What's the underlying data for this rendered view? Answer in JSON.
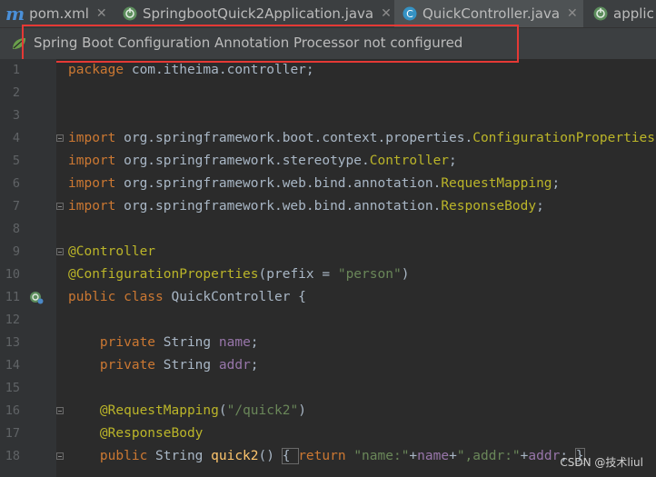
{
  "tabs": [
    {
      "icon": "maven-m-icon",
      "label": "pom.xml",
      "active": false
    },
    {
      "icon": "spring-boot-icon",
      "label": "SpringbootQuick2Application.java",
      "active": false
    },
    {
      "icon": "java-class-icon",
      "label": "QuickController.java",
      "active": true
    },
    {
      "icon": "spring-boot-icon",
      "label": "applic",
      "active": false
    }
  ],
  "tab_close_glyph": "✕",
  "banner": {
    "text": "Spring Boot Configuration Annotation Processor not configured"
  },
  "editor": {
    "lines": [
      {
        "n": "1",
        "code": [
          [
            "kw",
            "package "
          ],
          [
            "",
            "com.itheima.controller;"
          ]
        ]
      },
      {
        "n": "2",
        "code": []
      },
      {
        "n": "3",
        "code": []
      },
      {
        "n": "4",
        "fold": true,
        "code": [
          [
            "kw",
            "import "
          ],
          [
            "",
            "org.springframework.boot.context.properties."
          ],
          [
            "ann",
            "ConfigurationProperties"
          ],
          [
            "",
            ";"
          ]
        ]
      },
      {
        "n": "5",
        "code": [
          [
            "kw",
            "import "
          ],
          [
            "",
            "org.springframework.stereotype."
          ],
          [
            "ann",
            "Controller"
          ],
          [
            "",
            ";"
          ]
        ]
      },
      {
        "n": "6",
        "code": [
          [
            "kw",
            "import "
          ],
          [
            "",
            "org.springframework.web.bind.annotation."
          ],
          [
            "ann",
            "RequestMapping"
          ],
          [
            "",
            ";"
          ]
        ]
      },
      {
        "n": "7",
        "fold": true,
        "code": [
          [
            "kw",
            "import "
          ],
          [
            "",
            "org.springframework.web.bind.annotation."
          ],
          [
            "ann",
            "ResponseBody"
          ],
          [
            "",
            ";"
          ]
        ]
      },
      {
        "n": "8",
        "code": []
      },
      {
        "n": "9",
        "fold": true,
        "code": [
          [
            "ann",
            "@Controller"
          ]
        ]
      },
      {
        "n": "10",
        "code": [
          [
            "ann",
            "@ConfigurationProperties"
          ],
          [
            "",
            "("
          ],
          [
            "",
            "prefix"
          ],
          [
            "",
            " = "
          ],
          [
            "str",
            "\"person\""
          ],
          [
            "",
            ")"
          ]
        ]
      },
      {
        "n": "11",
        "bean": true,
        "code": [
          [
            "kw",
            "public class "
          ],
          [
            "",
            "QuickController {"
          ]
        ]
      },
      {
        "n": "12",
        "code": []
      },
      {
        "n": "13",
        "code": [
          [
            "",
            "    "
          ],
          [
            "kw",
            "private "
          ],
          [
            "",
            "String "
          ],
          [
            "fld",
            "name"
          ],
          [
            "",
            ";"
          ]
        ]
      },
      {
        "n": "14",
        "code": [
          [
            "",
            "    "
          ],
          [
            "kw",
            "private "
          ],
          [
            "",
            "String "
          ],
          [
            "fld",
            "addr"
          ],
          [
            "",
            ";"
          ]
        ]
      },
      {
        "n": "15",
        "code": []
      },
      {
        "n": "16",
        "fold": true,
        "code": [
          [
            "",
            "    "
          ],
          [
            "ann",
            "@RequestMapping"
          ],
          [
            "",
            "("
          ],
          [
            "str",
            "\"/quick2\""
          ],
          [
            "",
            ")"
          ]
        ]
      },
      {
        "n": "17",
        "code": [
          [
            "",
            "    "
          ],
          [
            "ann",
            "@ResponseBody"
          ]
        ]
      },
      {
        "n": "18",
        "fold": true,
        "code": [
          [
            "",
            "    "
          ],
          [
            "kw",
            "public "
          ],
          [
            "",
            "String "
          ],
          [
            "fn",
            "quick2"
          ],
          [
            "",
            "() "
          ],
          [
            "box",
            "{ "
          ],
          [
            "kw",
            "return "
          ],
          [
            "str",
            "\"name:\""
          ],
          [
            "",
            "+"
          ],
          [
            "fld",
            "name"
          ],
          [
            "",
            "+"
          ],
          [
            "str",
            "\",addr:\""
          ],
          [
            "",
            "+"
          ],
          [
            "fld",
            "addr"
          ],
          [
            "",
            "; "
          ],
          [
            "box",
            "}"
          ]
        ]
      }
    ]
  },
  "watermark": "CSDN @技术liul",
  "colors": {
    "editor_bg": "#2b2b2b",
    "keyword": "#cc7832",
    "annotation": "#bbb529",
    "string": "#6a8759",
    "field": "#9876aa",
    "method": "#ffc66d",
    "highlight_box": "#e53935"
  }
}
